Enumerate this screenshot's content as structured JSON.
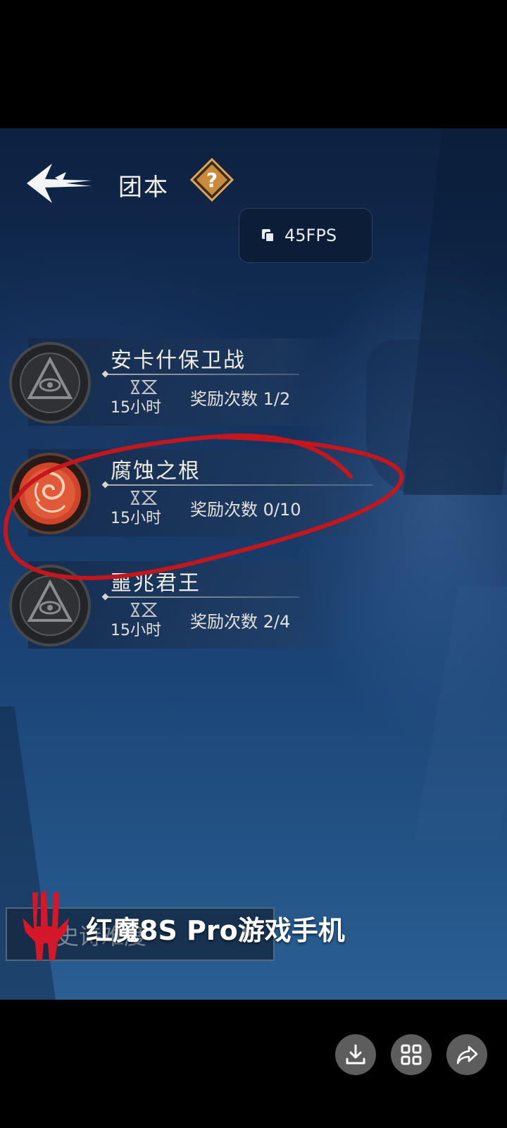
{
  "header": {
    "title": "团本",
    "help_icon": "question-mark-icon",
    "back_icon": "back-arrow-icon"
  },
  "fps": {
    "label": "45FPS"
  },
  "raids": [
    {
      "name": "安卡什保卫战",
      "time": "15小时",
      "reward": "奖励次数 1/2",
      "emblem": "eye-pyramid-icon",
      "active": false
    },
    {
      "name": "腐蚀之根",
      "time": "15小时",
      "reward": "奖励次数 0/10",
      "emblem": "red-swirl-icon",
      "active": true
    },
    {
      "name": "噩兆君王",
      "time": "15小时",
      "reward": "奖励次数 2/4",
      "emblem": "eye-pyramid-icon",
      "active": false
    }
  ],
  "difficulty": {
    "label": "史诗难度"
  },
  "watermark": {
    "text": "红魔8S Pro游戏手机"
  },
  "actions": [
    {
      "name": "download",
      "icon": "download-icon"
    },
    {
      "name": "grid",
      "icon": "grid-icon"
    },
    {
      "name": "share",
      "icon": "share-icon"
    }
  ],
  "colors": {
    "highlight": "#c4161c",
    "accent": "#c98a3c"
  }
}
